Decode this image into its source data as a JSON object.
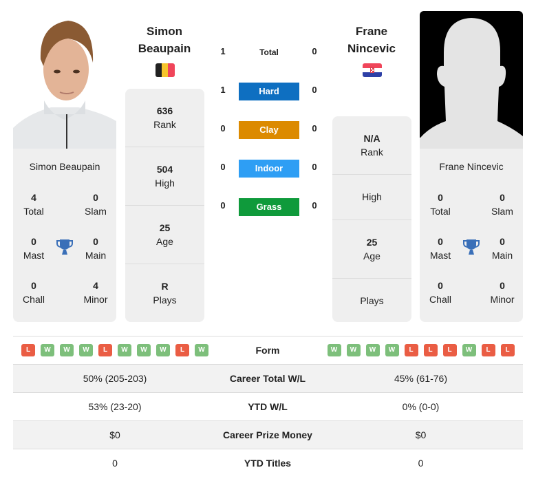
{
  "colors": {
    "hard": "#0e6fc1",
    "clay": "#dc8a00",
    "indoor": "#2e9ef4",
    "grass": "#0f9a3b",
    "win": "#7dbf7b",
    "loss": "#ea5d44",
    "trophy": "#3a6fb8"
  },
  "player1": {
    "name_line1": "Simon",
    "name_line2": "Beaupain",
    "full_name": "Simon Beaupain",
    "flag": "Belgium",
    "rank": "636",
    "rank_label": "Rank",
    "high": "504",
    "high_label": "High",
    "age": "25",
    "age_label": "Age",
    "plays": "R",
    "plays_label": "Plays",
    "titles": {
      "total": "4",
      "total_label": "Total",
      "slam": "0",
      "slam_label": "Slam",
      "mast": "0",
      "mast_label": "Mast",
      "main": "0",
      "main_label": "Main",
      "chall": "0",
      "chall_label": "Chall",
      "minor": "4",
      "minor_label": "Minor"
    },
    "form": [
      "L",
      "W",
      "W",
      "W",
      "L",
      "W",
      "W",
      "W",
      "L",
      "W"
    ]
  },
  "player2": {
    "name_line1": "Frane",
    "name_line2": "Nincevic",
    "full_name": "Frane Nincevic",
    "flag": "Croatia",
    "rank": "N/A",
    "rank_label": "Rank",
    "high": "",
    "high_label": "High",
    "age": "25",
    "age_label": "Age",
    "plays": "",
    "plays_label": "Plays",
    "titles": {
      "total": "0",
      "total_label": "Total",
      "slam": "0",
      "slam_label": "Slam",
      "mast": "0",
      "mast_label": "Mast",
      "main": "0",
      "main_label": "Main",
      "chall": "0",
      "chall_label": "Chall",
      "minor": "0",
      "minor_label": "Minor"
    },
    "form": [
      "W",
      "W",
      "W",
      "W",
      "L",
      "L",
      "L",
      "W",
      "L",
      "L"
    ]
  },
  "h2h": {
    "total": {
      "label": "Total",
      "p1": "1",
      "p2": "0"
    },
    "surfaces": [
      {
        "label": "Hard",
        "p1": "1",
        "p2": "0"
      },
      {
        "label": "Clay",
        "p1": "0",
        "p2": "0"
      },
      {
        "label": "Indoor",
        "p1": "0",
        "p2": "0"
      },
      {
        "label": "Grass",
        "p1": "0",
        "p2": "0"
      }
    ]
  },
  "table": {
    "form_label": "Form",
    "rows": [
      {
        "label": "Career Total W/L",
        "p1": "50% (205-203)",
        "p2": "45% (61-76)"
      },
      {
        "label": "YTD W/L",
        "p1": "53% (23-20)",
        "p2": "0% (0-0)"
      },
      {
        "label": "Career Prize Money",
        "p1": "$0",
        "p2": "$0"
      },
      {
        "label": "YTD Titles",
        "p1": "0",
        "p2": "0"
      }
    ]
  }
}
